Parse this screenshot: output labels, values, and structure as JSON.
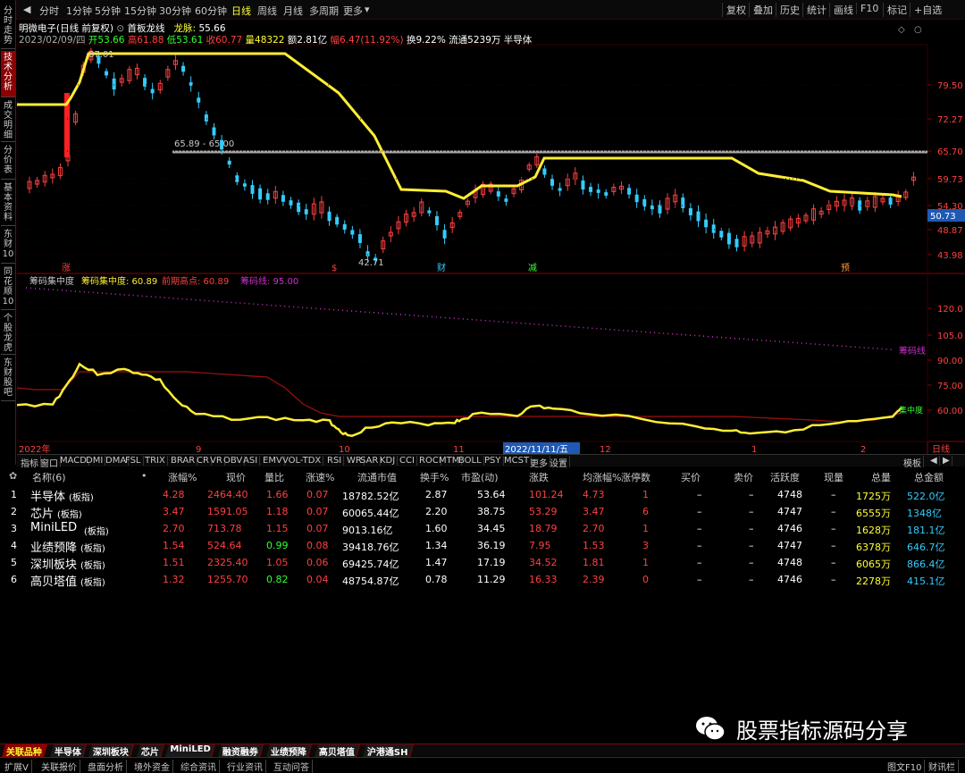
{
  "toolbar": {
    "periods": [
      "分时",
      "1分钟",
      "5分钟",
      "15分钟",
      "30分钟",
      "60分钟",
      "日线",
      "周线",
      "月线",
      "多周期",
      "更多"
    ],
    "active_period": "日线",
    "right_buttons": [
      "复权",
      "叠加",
      "历史",
      "统计",
      "画线",
      "F10",
      "标记",
      "+自选"
    ]
  },
  "side_tabs": [
    "分时走势",
    "技术分析",
    "成交明细",
    "分价表",
    "基本资料",
    "东财10",
    "同花顺10",
    "个股龙虎",
    "东财股吧"
  ],
  "stock": {
    "title": "明微电子(日线 前复权)",
    "indicator_name": "首板龙线",
    "dragon_label": "龙脉:",
    "dragon_value": "55.66",
    "date_line": "2023/02/09/四",
    "open": "开53.66",
    "high": "高61.88",
    "low": "低53.61",
    "close": "收60.77",
    "volume": "量48322",
    "amount": "额2.81亿",
    "change": "幅6.47(11.92%)",
    "turnover": "换9.22%",
    "float": "流通5239万",
    "sector": "半导体",
    "current_price_tag": "50.73",
    "price_axis": [
      "79.50",
      "72.27",
      "65.70",
      "59.73",
      "54.30",
      "48.87",
      "43.98"
    ],
    "high_mark": "87.01",
    "low_mark": "42.71",
    "resistance_label": "65.89 - 65.00",
    "event_marks": [
      "涨",
      "$",
      "财",
      "减",
      "预"
    ]
  },
  "sub": {
    "name": "筹码集中度",
    "c1_label": "筹码集中度: 60.89",
    "c2_label": "前期高点: 60.89",
    "c3_label": "筹码线: 95.00",
    "axis": [
      "120.0",
      "105.0",
      "90.00",
      "75.00",
      "60.00"
    ],
    "line_tag": "筹码线",
    "yellow_tag": "集中度"
  },
  "date_axis": [
    "2022年",
    "9",
    "10",
    "11",
    "2022/11/11/五",
    "12",
    "1",
    "2",
    "日线"
  ],
  "indicators": [
    "指标",
    "窗口",
    "MACD",
    "DMI",
    "DMA",
    "FSL",
    "TRIX",
    "BRAR",
    "CR",
    "VR",
    "OBV",
    "ASI",
    "EMV",
    "VOL-TDX",
    "RSI",
    "WR",
    "SAR",
    "KDJ",
    "CCI",
    "ROC",
    "MTM",
    "BOLL",
    "PSY",
    "MCST",
    "更多",
    "设置"
  ],
  "template_label": "模板",
  "table": {
    "headers": [
      "名称(6)",
      "•",
      "涨幅%",
      "现价",
      "量比",
      "涨速%",
      "流通市值",
      "换手%",
      "市盈(动)",
      "涨跌",
      "均涨幅%",
      "涨停数",
      "买价",
      "卖价",
      "活跃度",
      "现量",
      "总量",
      "总金额"
    ],
    "rows": [
      {
        "idx": "1",
        "name": "半导体",
        "tag": "(板指)",
        "chg": "4.28",
        "price": "2464.40",
        "vr": "1.66",
        "speed": "0.07",
        "mcap": "18782.52亿",
        "turn": "2.87",
        "pe": "53.64",
        "diff": "101.24",
        "avg": "4.73",
        "limit": "1",
        "bid": "–",
        "ask": "–",
        "act": "4748",
        "cur": "–",
        "vol": "1725万",
        "amt": "522.0亿"
      },
      {
        "idx": "2",
        "name": "芯片",
        "tag": "(板指)",
        "chg": "3.47",
        "price": "1591.05",
        "vr": "1.18",
        "speed": "0.07",
        "mcap": "60065.44亿",
        "turn": "2.20",
        "pe": "38.75",
        "diff": "53.29",
        "avg": "3.47",
        "limit": "6",
        "bid": "–",
        "ask": "–",
        "act": "4747",
        "cur": "–",
        "vol": "6555万",
        "amt": "1348亿"
      },
      {
        "idx": "3",
        "name": "MiniLED",
        "tag": "(板指)",
        "chg": "2.70",
        "price": "713.78",
        "vr": "1.15",
        "speed": "0.07",
        "mcap": "9013.16亿",
        "turn": "1.60",
        "pe": "34.45",
        "diff": "18.79",
        "avg": "2.70",
        "limit": "1",
        "bid": "–",
        "ask": "–",
        "act": "4746",
        "cur": "–",
        "vol": "1628万",
        "amt": "181.1亿"
      },
      {
        "idx": "4",
        "name": "业绩预降",
        "tag": "(板指)",
        "chg": "1.54",
        "price": "524.64",
        "vr": "0.99",
        "speed": "0.08",
        "mcap": "39418.76亿",
        "turn": "1.34",
        "pe": "36.19",
        "diff": "7.95",
        "avg": "1.53",
        "limit": "3",
        "bid": "–",
        "ask": "–",
        "act": "4747",
        "cur": "–",
        "vol": "6378万",
        "amt": "646.7亿"
      },
      {
        "idx": "5",
        "name": "深圳板块",
        "tag": "(板指)",
        "chg": "1.51",
        "price": "2325.40",
        "vr": "1.05",
        "speed": "0.06",
        "mcap": "69425.74亿",
        "turn": "1.47",
        "pe": "17.19",
        "diff": "34.52",
        "avg": "1.81",
        "limit": "1",
        "bid": "–",
        "ask": "–",
        "act": "4748",
        "cur": "–",
        "vol": "6065万",
        "amt": "866.4亿"
      },
      {
        "idx": "6",
        "name": "高贝塔值",
        "tag": "(板指)",
        "chg": "1.32",
        "price": "1255.70",
        "vr": "0.82",
        "speed": "0.04",
        "mcap": "48754.87亿",
        "turn": "0.78",
        "pe": "11.29",
        "diff": "16.33",
        "avg": "2.39",
        "limit": "0",
        "bid": "–",
        "ask": "–",
        "act": "4746",
        "cur": "–",
        "vol": "2278万",
        "amt": "415.1亿"
      }
    ]
  },
  "bottom_tabs": [
    "关联品种",
    "半导体",
    "深圳板块",
    "芯片",
    "MiniLED",
    "融资融券",
    "业绩预降",
    "高贝塔值",
    "沪港通SH"
  ],
  "status_items": [
    "扩展V",
    "关联报价",
    "盘面分析",
    "境外资金",
    "综合资讯",
    "行业资讯",
    "互动问答"
  ],
  "status_right": [
    "图文F10",
    "财讯栏"
  ],
  "watermark": "股票指标源码分享",
  "colors": {
    "up": "#ff4040",
    "down": "#33ccff",
    "dragon": "#ffee33",
    "accent": "#8b0000"
  }
}
